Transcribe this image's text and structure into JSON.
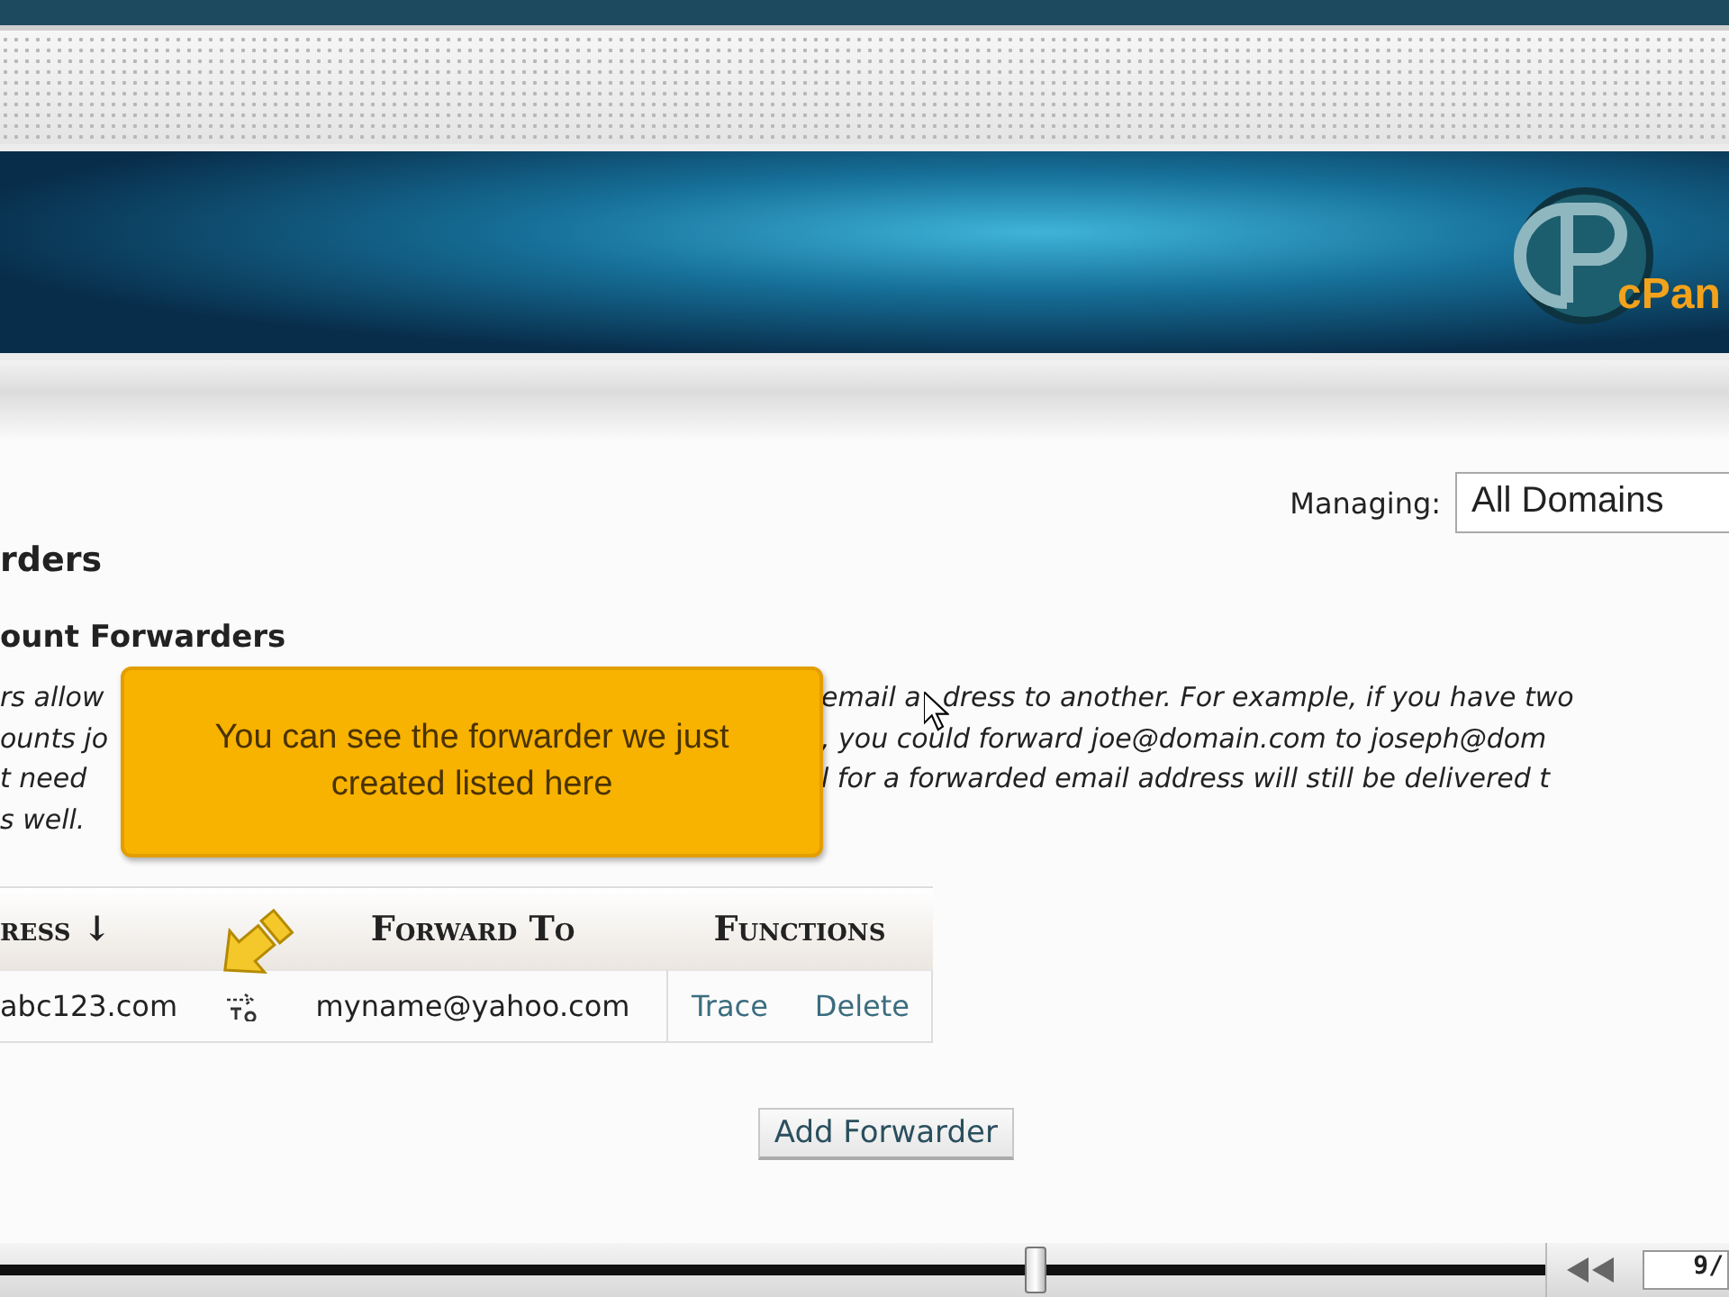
{
  "banner": {
    "logo_text": "cPan"
  },
  "managing": {
    "label": "Managing:",
    "value": "All Domains"
  },
  "page_title": "rders",
  "section_title": "ount Forwarders",
  "description_lines": [
    {
      "left": "rs allow",
      "right": "email a",
      "after_cursor": "dress to another. For example, if you have two"
    },
    {
      "left": "ounts jo",
      "right": ", you could forward joe@domain.com to joseph@dom"
    },
    {
      "left": "t need",
      "right": "l for a forwarded email address will still be delivered t"
    },
    {
      "left": "s well."
    }
  ],
  "tooltip": {
    "text": "You can see the forwarder we just created listed here"
  },
  "table": {
    "columns": [
      "ress ↓",
      "Forward To",
      "Functions"
    ],
    "rows": [
      {
        "address": "abc123.com",
        "forward_to": "myname@yahoo.com",
        "actions": [
          "Trace",
          "Delete"
        ]
      }
    ]
  },
  "add_button": "Add Forwarder",
  "player": {
    "level": 0.67,
    "page": "9/"
  }
}
